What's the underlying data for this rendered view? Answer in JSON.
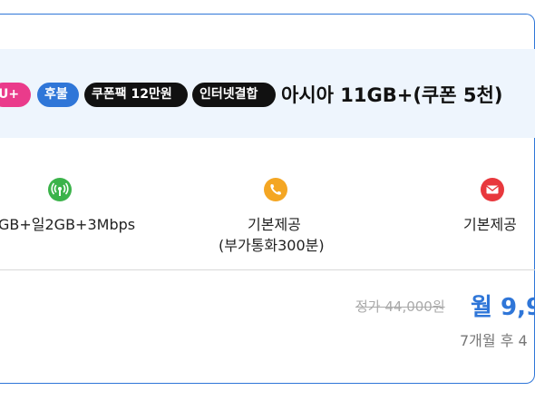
{
  "tags": {
    "carrier": "U+",
    "payment": "후불",
    "coupon": "쿠폰팩 12만원",
    "bundle": "인터넷결합"
  },
  "plan": {
    "title": "아시아 11GB+(쿠폰 5천)"
  },
  "features": {
    "data": "GB+일2GB+3Mbps",
    "call_line1": "기본제공",
    "call_line2": "(부가통화300분)",
    "sms": "기본제공"
  },
  "icons": {
    "data": "antenna-icon",
    "call": "phone-icon",
    "sms": "mail-icon"
  },
  "colors": {
    "accent": "#2f76d8",
    "carrier_tag": "#ea3b8b",
    "data_icon": "#3bb34a",
    "call_icon": "#f4a623",
    "sms_icon": "#e8383d"
  },
  "price": {
    "original": "정가 44,000원",
    "monthly": "월 9,9",
    "after": "7개월 후 4"
  }
}
